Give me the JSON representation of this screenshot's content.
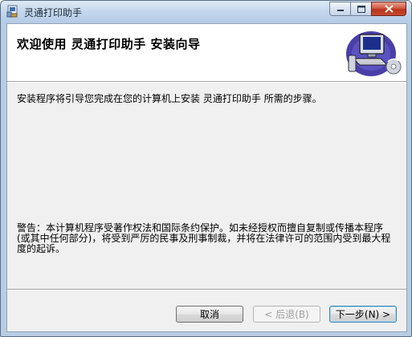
{
  "window": {
    "title": "灵通打印助手",
    "controls": {
      "minimize": "minimize",
      "maximize": "maximize",
      "close": "close"
    }
  },
  "banner": {
    "title": "欢迎使用  灵通打印助手  安装向导",
    "art_icon": "computer-setup-icon"
  },
  "body": {
    "intro": "安装程序将引导您完成在您的计算机上安装  灵通打印助手  所需的步骤。",
    "warning": "警告：本计算机程序受著作权法和国际条约保护。如未经授权而擅自复制或传播本程序(或其中任何部分)，将受到严厉的民事及刑事制裁，并将在法律许可的范围内受到最大程度的起诉。"
  },
  "buttons": {
    "cancel": "取消",
    "back": "< 后退(B)",
    "next": "下一步(N) >"
  },
  "colors": {
    "title_bar": "#c4d7ec",
    "client_bg": "#f0f0f0",
    "close_button": "#c84b30",
    "default_button_border": "#3c7fb1"
  }
}
